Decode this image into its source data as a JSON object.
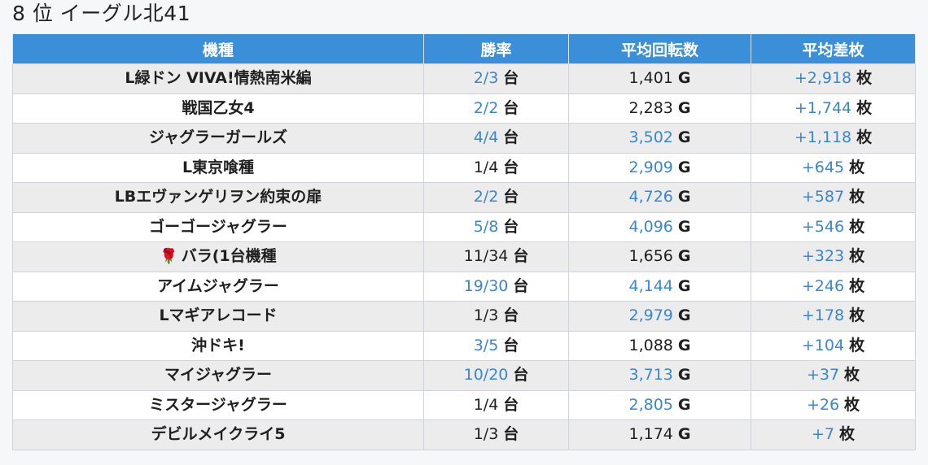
{
  "page": {
    "title": "8 位 イーグル北41"
  },
  "table": {
    "headers": [
      "機種",
      "勝率",
      "平均回転数",
      "平均差枚"
    ],
    "units": {
      "rate": "台",
      "spins": "G",
      "diff": "枚"
    },
    "rows": [
      {
        "name": "L緑ドン VIVA!情熱南米編",
        "icon": "",
        "rate": "2/3",
        "rate_link": true,
        "spins": "1,401",
        "spins_link": false,
        "diff": "+2,918",
        "diff_link": true
      },
      {
        "name": "戦国乙女4",
        "icon": "",
        "rate": "2/2",
        "rate_link": true,
        "spins": "2,283",
        "spins_link": false,
        "diff": "+1,744",
        "diff_link": true
      },
      {
        "name": "ジャグラーガールズ",
        "icon": "",
        "rate": "4/4",
        "rate_link": true,
        "spins": "3,502",
        "spins_link": true,
        "diff": "+1,118",
        "diff_link": true
      },
      {
        "name": "L東京喰種",
        "icon": "",
        "rate": "1/4",
        "rate_link": false,
        "spins": "2,909",
        "spins_link": true,
        "diff": "+645",
        "diff_link": true
      },
      {
        "name": "LBエヴァンゲリヲン約束の扉",
        "icon": "",
        "rate": "2/2",
        "rate_link": true,
        "spins": "4,726",
        "spins_link": true,
        "diff": "+587",
        "diff_link": true
      },
      {
        "name": "ゴーゴージャグラー",
        "icon": "",
        "rate": "5/8",
        "rate_link": true,
        "spins": "4,096",
        "spins_link": true,
        "diff": "+546",
        "diff_link": true
      },
      {
        "name": "バラ(1台機種",
        "icon": "rose-icon",
        "rate": "11/34",
        "rate_link": false,
        "spins": "1,656",
        "spins_link": false,
        "diff": "+323",
        "diff_link": true
      },
      {
        "name": "アイムジャグラー",
        "icon": "",
        "rate": "19/30",
        "rate_link": true,
        "spins": "4,144",
        "spins_link": true,
        "diff": "+246",
        "diff_link": true
      },
      {
        "name": "Lマギアレコード",
        "icon": "",
        "rate": "1/3",
        "rate_link": false,
        "spins": "2,979",
        "spins_link": true,
        "diff": "+178",
        "diff_link": true
      },
      {
        "name": "沖ドキ!",
        "icon": "",
        "rate": "3/5",
        "rate_link": true,
        "spins": "1,088",
        "spins_link": false,
        "diff": "+104",
        "diff_link": true
      },
      {
        "name": "マイジャグラー",
        "icon": "",
        "rate": "10/20",
        "rate_link": true,
        "spins": "3,713",
        "spins_link": true,
        "diff": "+37",
        "diff_link": true
      },
      {
        "name": "ミスタージャグラー",
        "icon": "",
        "rate": "1/4",
        "rate_link": false,
        "spins": "2,805",
        "spins_link": true,
        "diff": "+26",
        "diff_link": true
      },
      {
        "name": "デビルメイクライ5",
        "icon": "",
        "rate": "1/3",
        "rate_link": false,
        "spins": "1,174",
        "spins_link": false,
        "diff": "+7",
        "diff_link": true
      }
    ]
  },
  "colors": {
    "header_bg": "#3a8fd8",
    "link": "#3a86cf",
    "row_alt": "#ececec"
  }
}
